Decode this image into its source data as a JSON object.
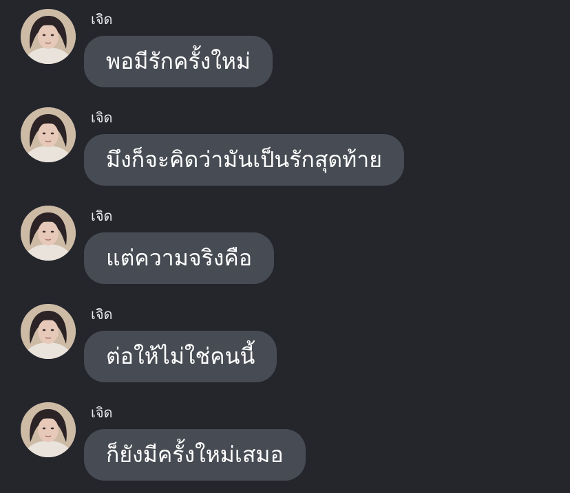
{
  "messages": [
    {
      "sender": "เจิด",
      "text": "พอมีรักครั้งใหม่",
      "avatar_icon": "profile-photo"
    },
    {
      "sender": "เจิด",
      "text": "มึงก็จะคิดว่ามันเป็นรักสุดท้าย",
      "avatar_icon": "profile-photo"
    },
    {
      "sender": "เจิด",
      "text": "แต่ความจริงคือ",
      "avatar_icon": "profile-photo"
    },
    {
      "sender": "เจิด",
      "text": "ต่อให้ไม่ใช่คนนี้",
      "avatar_icon": "profile-photo"
    },
    {
      "sender": "เจิด",
      "text": "ก็ยังมีครั้งใหม่เสมอ",
      "avatar_icon": "profile-photo"
    }
  ],
  "colors": {
    "background": "#24262c",
    "bubble": "#474b53",
    "text": "#ffffff"
  }
}
